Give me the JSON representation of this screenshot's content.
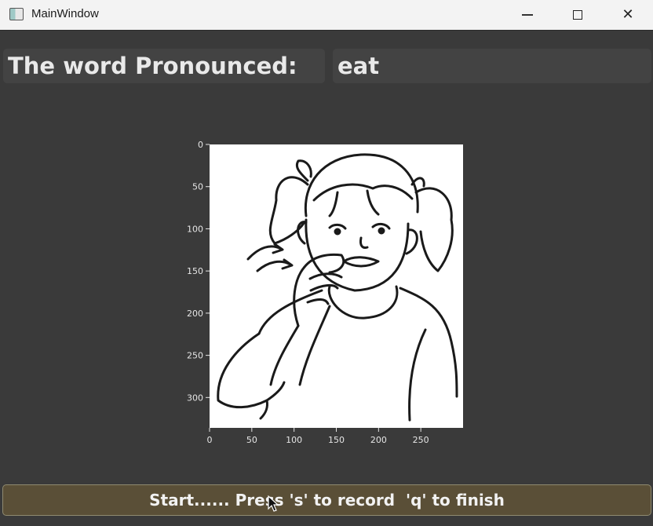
{
  "window": {
    "title": "MainWindow",
    "icon": "app-window-icon",
    "controls": {
      "minimize": "minimize-icon",
      "maximize": "maximize-icon",
      "close": "close-icon"
    }
  },
  "header": {
    "label": "The word Pronounced:",
    "word": "eat"
  },
  "plot": {
    "image": "line drawing of a girl signing the word eat",
    "y_ticks": [
      "0",
      "50",
      "100",
      "150",
      "200",
      "250",
      "300"
    ],
    "x_ticks": [
      "0",
      "50",
      "100",
      "150",
      "200",
      "250"
    ],
    "x_range": [
      0,
      300
    ],
    "y_range": [
      0,
      336
    ]
  },
  "status": {
    "text": "Start...... Press 's' to record  'q' to finish",
    "background": "#5a4f37"
  }
}
